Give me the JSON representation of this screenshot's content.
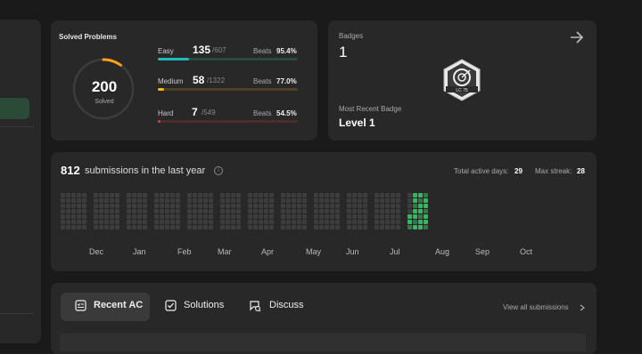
{
  "solved": {
    "title": "Solved Problems",
    "total": "200",
    "label": "Solved",
    "difficulties": [
      {
        "name": "Easy",
        "count": "135",
        "total": "/607",
        "beats_label": "Beats",
        "beats": "95.4%",
        "fill": 0.222,
        "color": "#1cbaba",
        "track": "#2a4a3c"
      },
      {
        "name": "Medium",
        "count": "58",
        "total": "/1322",
        "beats_label": "Beats",
        "beats": "77.0%",
        "fill": 0.044,
        "color": "#ffb700",
        "track": "#4f4125"
      },
      {
        "name": "Hard",
        "count": "7",
        "total": "/549",
        "beats_label": "Beats",
        "beats": "54.5%",
        "fill": 0.013,
        "color": "#f63737",
        "track": "#4d2b28"
      }
    ]
  },
  "badges": {
    "label": "Badges",
    "count": "1",
    "badge_icon_label": "LC 75",
    "recent_label": "Most Recent Badge",
    "recent_name": "Level 1"
  },
  "submissions": {
    "count": "812",
    "text": "submissions in the last year",
    "active_days_label": "Total active days:",
    "active_days": "29",
    "max_streak_label": "Max streak:",
    "max_streak": "28",
    "months": [
      "Dec",
      "Jan",
      "Feb",
      "Mar",
      "Apr",
      "May",
      "Jun",
      "Jul",
      "Aug",
      "Sep",
      "Oct"
    ]
  },
  "tabs": {
    "recent_ac": "Recent AC",
    "solutions": "Solutions",
    "discuss": "Discuss",
    "view_all": "View all submissions"
  },
  "colors": {
    "accent": "#ffa116",
    "green": "#2cbb5d",
    "empty_cell": "#3d3d3d"
  }
}
